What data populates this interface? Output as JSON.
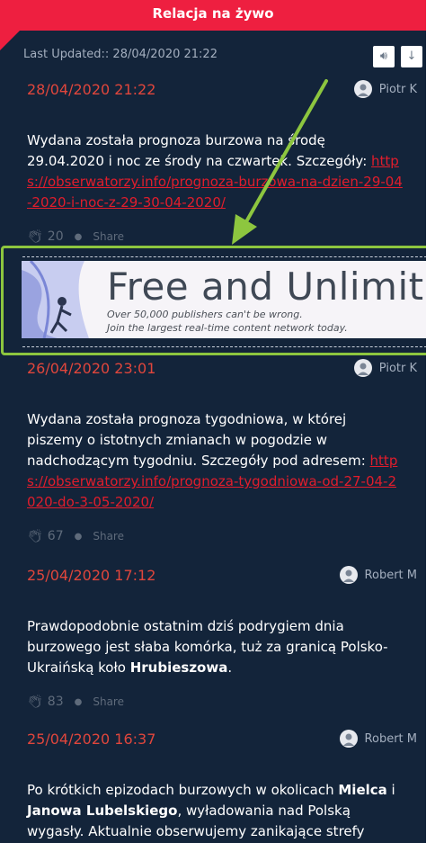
{
  "header": {
    "title": "Relacja na żywo"
  },
  "meta": {
    "last_updated": "Last Updated:: 28/04/2020 21:22"
  },
  "controls": {
    "sound_icon": "speaker-icon",
    "download_icon": "arrow-down-icon"
  },
  "posts": [
    {
      "date": "28/04/2020 21:22",
      "author": "Piotr K",
      "text_before": "Wydana została prognoza burzowa na środę 29.04.2020 i noc ze środy na czwartek. Szczegóły: ",
      "link": "https://obserwatorzy.info/prognoza-burzowa-na-dzien-29-04-2020-i-noc-z-29-30-04-2020/",
      "claps": "20",
      "share": "Share"
    },
    {
      "date": "26/04/2020 23:01",
      "author": "Piotr K",
      "text_before": "Wydana została prognoza tygodniowa, w której piszemy o istotnych zmianach w pogodzie w nadchodzącym tygodniu. Szczegóły pod adresem: ",
      "link": "https://obserwatorzy.info/prognoza-tygodniowa-od-27-04-2020-do-3-05-2020/",
      "claps": "67",
      "share": "Share"
    },
    {
      "date": "25/04/2020 17:12",
      "author": "Robert M",
      "text_before": "Prawdopodobnie ostatnim dziś podrygiem dnia burzowego jest słaba komórka, tuż za granicą Polsko-Ukraińską koło ",
      "bold1": "Hrubieszowa",
      "text_after": ".",
      "claps": "83",
      "share": "Share"
    },
    {
      "date": "25/04/2020 16:37",
      "author": "Robert M",
      "text_before": "Po krótkich epizodach burzowych w okolicach ",
      "bold1": "Mielca",
      "mid1": " i ",
      "bold2": "Janowa Lubelskiego",
      "text_after": ", wyładowania nad Polską wygasły. Aktualnie obserwujemy zanikające strefy opadów nad"
    }
  ],
  "ad": {
    "title": "Free and Unlimit",
    "line1": "Over 50,000 publishers can't be wrong.",
    "line2": "Join the largest real-time content network today."
  },
  "colors": {
    "header": "#ee1f40",
    "background": "#13243a",
    "date": "#e0463c",
    "link": "#e11d2c",
    "highlight": "#8dc63f"
  }
}
